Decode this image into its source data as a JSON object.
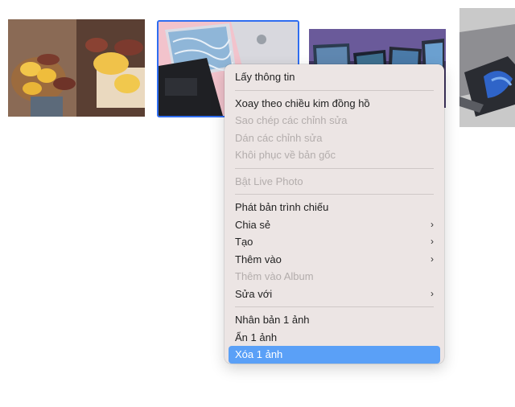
{
  "photos": [
    {
      "name": "sweet-potatoes"
    },
    {
      "name": "laptop-pink-desk",
      "selected": true
    },
    {
      "name": "laptops-purple"
    },
    {
      "name": "tablet-device"
    }
  ],
  "context_menu": {
    "group1": [
      {
        "label": "Lấy thông tin",
        "enabled": true
      }
    ],
    "group2": [
      {
        "label": "Xoay theo chiều kim đồng hồ",
        "enabled": true
      },
      {
        "label": "Sao chép các chỉnh sửa",
        "enabled": false
      },
      {
        "label": "Dán các chỉnh sửa",
        "enabled": false
      },
      {
        "label": "Khôi phục về bản gốc",
        "enabled": false
      }
    ],
    "group3": [
      {
        "label": "Bật Live Photo",
        "enabled": false
      }
    ],
    "group4": [
      {
        "label": "Phát bản trình chiếu",
        "enabled": true
      },
      {
        "label": "Chia sẻ",
        "enabled": true,
        "submenu": true
      },
      {
        "label": "Tạo",
        "enabled": true,
        "submenu": true
      },
      {
        "label": "Thêm vào",
        "enabled": true,
        "submenu": true
      },
      {
        "label": "Thêm vào Album",
        "enabled": false
      },
      {
        "label": "Sửa với",
        "enabled": true,
        "submenu": true
      }
    ],
    "group5": [
      {
        "label": "Nhân bản 1 ảnh",
        "enabled": true
      },
      {
        "label": "Ẩn 1 ảnh",
        "enabled": true
      },
      {
        "label": "Xóa 1 ảnh",
        "enabled": true,
        "highlighted": true
      }
    ],
    "chevron_glyph": "›"
  },
  "colors": {
    "selection_border": "#2f6df0",
    "menu_background": "#ece5e4",
    "highlight": "#5aa0f7"
  }
}
